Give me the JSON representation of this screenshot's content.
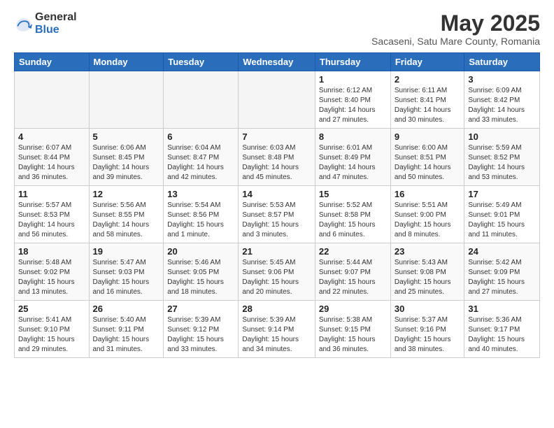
{
  "logo": {
    "general": "General",
    "blue": "Blue"
  },
  "header": {
    "month_year": "May 2025",
    "location": "Sacaseni, Satu Mare County, Romania"
  },
  "weekdays": [
    "Sunday",
    "Monday",
    "Tuesday",
    "Wednesday",
    "Thursday",
    "Friday",
    "Saturday"
  ],
  "weeks": [
    [
      {
        "num": "",
        "info": ""
      },
      {
        "num": "",
        "info": ""
      },
      {
        "num": "",
        "info": ""
      },
      {
        "num": "",
        "info": ""
      },
      {
        "num": "1",
        "info": "Sunrise: 6:12 AM\nSunset: 8:40 PM\nDaylight: 14 hours\nand 27 minutes."
      },
      {
        "num": "2",
        "info": "Sunrise: 6:11 AM\nSunset: 8:41 PM\nDaylight: 14 hours\nand 30 minutes."
      },
      {
        "num": "3",
        "info": "Sunrise: 6:09 AM\nSunset: 8:42 PM\nDaylight: 14 hours\nand 33 minutes."
      }
    ],
    [
      {
        "num": "4",
        "info": "Sunrise: 6:07 AM\nSunset: 8:44 PM\nDaylight: 14 hours\nand 36 minutes."
      },
      {
        "num": "5",
        "info": "Sunrise: 6:06 AM\nSunset: 8:45 PM\nDaylight: 14 hours\nand 39 minutes."
      },
      {
        "num": "6",
        "info": "Sunrise: 6:04 AM\nSunset: 8:47 PM\nDaylight: 14 hours\nand 42 minutes."
      },
      {
        "num": "7",
        "info": "Sunrise: 6:03 AM\nSunset: 8:48 PM\nDaylight: 14 hours\nand 45 minutes."
      },
      {
        "num": "8",
        "info": "Sunrise: 6:01 AM\nSunset: 8:49 PM\nDaylight: 14 hours\nand 47 minutes."
      },
      {
        "num": "9",
        "info": "Sunrise: 6:00 AM\nSunset: 8:51 PM\nDaylight: 14 hours\nand 50 minutes."
      },
      {
        "num": "10",
        "info": "Sunrise: 5:59 AM\nSunset: 8:52 PM\nDaylight: 14 hours\nand 53 minutes."
      }
    ],
    [
      {
        "num": "11",
        "info": "Sunrise: 5:57 AM\nSunset: 8:53 PM\nDaylight: 14 hours\nand 56 minutes."
      },
      {
        "num": "12",
        "info": "Sunrise: 5:56 AM\nSunset: 8:55 PM\nDaylight: 14 hours\nand 58 minutes."
      },
      {
        "num": "13",
        "info": "Sunrise: 5:54 AM\nSunset: 8:56 PM\nDaylight: 15 hours\nand 1 minute."
      },
      {
        "num": "14",
        "info": "Sunrise: 5:53 AM\nSunset: 8:57 PM\nDaylight: 15 hours\nand 3 minutes."
      },
      {
        "num": "15",
        "info": "Sunrise: 5:52 AM\nSunset: 8:58 PM\nDaylight: 15 hours\nand 6 minutes."
      },
      {
        "num": "16",
        "info": "Sunrise: 5:51 AM\nSunset: 9:00 PM\nDaylight: 15 hours\nand 8 minutes."
      },
      {
        "num": "17",
        "info": "Sunrise: 5:49 AM\nSunset: 9:01 PM\nDaylight: 15 hours\nand 11 minutes."
      }
    ],
    [
      {
        "num": "18",
        "info": "Sunrise: 5:48 AM\nSunset: 9:02 PM\nDaylight: 15 hours\nand 13 minutes."
      },
      {
        "num": "19",
        "info": "Sunrise: 5:47 AM\nSunset: 9:03 PM\nDaylight: 15 hours\nand 16 minutes."
      },
      {
        "num": "20",
        "info": "Sunrise: 5:46 AM\nSunset: 9:05 PM\nDaylight: 15 hours\nand 18 minutes."
      },
      {
        "num": "21",
        "info": "Sunrise: 5:45 AM\nSunset: 9:06 PM\nDaylight: 15 hours\nand 20 minutes."
      },
      {
        "num": "22",
        "info": "Sunrise: 5:44 AM\nSunset: 9:07 PM\nDaylight: 15 hours\nand 22 minutes."
      },
      {
        "num": "23",
        "info": "Sunrise: 5:43 AM\nSunset: 9:08 PM\nDaylight: 15 hours\nand 25 minutes."
      },
      {
        "num": "24",
        "info": "Sunrise: 5:42 AM\nSunset: 9:09 PM\nDaylight: 15 hours\nand 27 minutes."
      }
    ],
    [
      {
        "num": "25",
        "info": "Sunrise: 5:41 AM\nSunset: 9:10 PM\nDaylight: 15 hours\nand 29 minutes."
      },
      {
        "num": "26",
        "info": "Sunrise: 5:40 AM\nSunset: 9:11 PM\nDaylight: 15 hours\nand 31 minutes."
      },
      {
        "num": "27",
        "info": "Sunrise: 5:39 AM\nSunset: 9:12 PM\nDaylight: 15 hours\nand 33 minutes."
      },
      {
        "num": "28",
        "info": "Sunrise: 5:39 AM\nSunset: 9:14 PM\nDaylight: 15 hours\nand 34 minutes."
      },
      {
        "num": "29",
        "info": "Sunrise: 5:38 AM\nSunset: 9:15 PM\nDaylight: 15 hours\nand 36 minutes."
      },
      {
        "num": "30",
        "info": "Sunrise: 5:37 AM\nSunset: 9:16 PM\nDaylight: 15 hours\nand 38 minutes."
      },
      {
        "num": "31",
        "info": "Sunrise: 5:36 AM\nSunset: 9:17 PM\nDaylight: 15 hours\nand 40 minutes."
      }
    ]
  ]
}
